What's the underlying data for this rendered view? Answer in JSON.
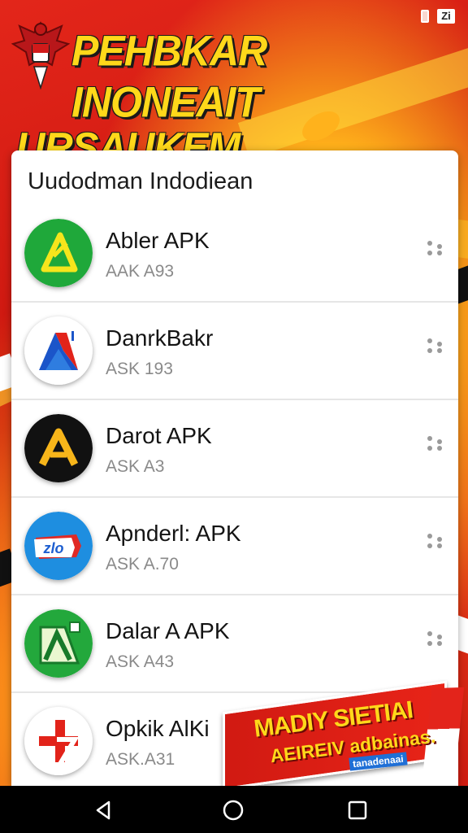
{
  "status": {
    "signal_text": "Zi"
  },
  "banner": {
    "line1": "PEHBKAR INONEAIT",
    "line2": "URSAUKEM ANDOK'SES!"
  },
  "list": {
    "title": "Uudodman Indodiean",
    "apps": [
      {
        "name": "Abler APK",
        "sub": "AAK A93",
        "icon": "green-triangle-icon"
      },
      {
        "name": "DanrkBakr",
        "sub": "ASK 193",
        "icon": "blue-red-k-icon"
      },
      {
        "name": "Darot APK",
        "sub": "ASK A3",
        "icon": "black-yellow-a-icon"
      },
      {
        "name": "Apnderl: APK",
        "sub": "ASK A.70",
        "icon": "blue-ticket-icon"
      },
      {
        "name": "Dalar A APK",
        "sub": "ASK A43",
        "icon": "green-a-icon"
      },
      {
        "name": "Opkik AlKi",
        "sub": "ASK.A31",
        "icon": "red-seven-icon"
      }
    ]
  },
  "promo": {
    "line1": "MADIY SIETIAI",
    "line2": "AEIREIV adbainas.",
    "line3": "tanadenaai"
  },
  "colors": {
    "accent_yellow": "#ffd81a",
    "background_red": "#d81c12"
  }
}
